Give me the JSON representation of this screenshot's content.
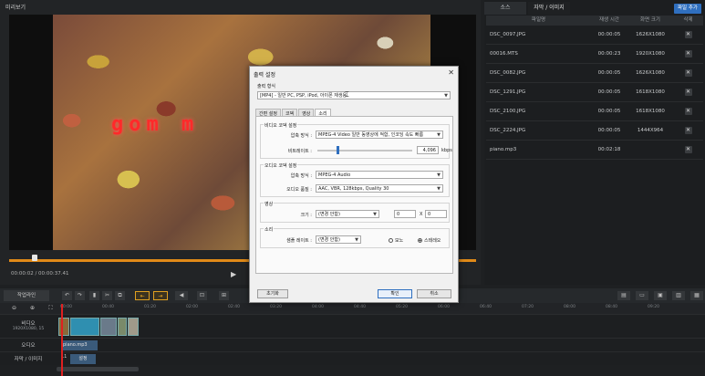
{
  "preview": {
    "title": "미리보기",
    "overlay_text": "gom m",
    "time": "00:00:02 / 00:00:37.41",
    "play_icon": "play-icon"
  },
  "source_panel": {
    "tabs": [
      "소스",
      "자막 / 이미지"
    ],
    "add_file_label": "파일 추가",
    "headers": {
      "name": "파일명",
      "duration": "재생 시간",
      "size": "화면 크기",
      "delete": "삭제"
    },
    "rows": [
      {
        "name": "DSC_0097.JPG",
        "duration": "00:00:05",
        "size": "1626X1080"
      },
      {
        "name": "00016.MTS",
        "duration": "00:00:23",
        "size": "1920X1080"
      },
      {
        "name": "DSC_0082.JPG",
        "duration": "00:00:05",
        "size": "1626X1080"
      },
      {
        "name": "DSC_1291.JPG",
        "duration": "00:00:05",
        "size": "1618X1080"
      },
      {
        "name": "DSC_2100.JPG",
        "duration": "00:00:05",
        "size": "1618X1080"
      },
      {
        "name": "DSC_2224.JPG",
        "duration": "00:00:05",
        "size": "1444X964"
      },
      {
        "name": "piano.mp3",
        "duration": "00:02:18",
        "size": ""
      }
    ],
    "delete_glyph": "✕"
  },
  "timeline": {
    "workline_label": "작업라인",
    "ruler": [
      "00:00",
      "00:40",
      "01:20",
      "02:00",
      "02:40",
      "03:20",
      "04:00",
      "04:40",
      "05:20",
      "06:00",
      "06:40",
      "07:20",
      "08:00",
      "08:40",
      "09:20"
    ],
    "tracks": {
      "video_label": "비디오",
      "video_sub": "1920X1080, 15",
      "audio_label": "오디오",
      "audio_clip": "piano.mp3",
      "subtitle_label": "자막 / 이미지",
      "subtitle_mark": "11",
      "subtitle_clip": "설정"
    }
  },
  "dialog": {
    "title": "출력 설정",
    "format_label": "출력 형식",
    "format_value": "[MP4] - 일반 PC, PSP, iPod, 아이폰 재생용",
    "tabs": [
      "간편 설정",
      "코덱",
      "영상",
      "소리"
    ],
    "video_codec_group": "비디오 코덱 설정",
    "compress_label": "압축 방식 :",
    "compress_value": "MPEG-4 Video 일반 동영상에 적합, 인코딩 속도 빠름",
    "bitrate_label": "비트레이트 :",
    "bitrate_value": "4,096",
    "bitrate_unit": "kbps",
    "bitrate_fraction": 0.2,
    "audio_codec_group": "오디오 코덱 설정",
    "audio_compress_label": "압축 방식 :",
    "audio_compress_value": "MPEG-4 Audio",
    "audio_quality_label": "오디오 품질 :",
    "audio_quality_value": "AAC, VBR, 128kbps, Quality 30",
    "video_group": "영상",
    "size_label": "크기 :",
    "size_value": "(변경 안함)",
    "width_value": "0",
    "height_value": "0",
    "times_glyph": "X",
    "sound_group": "소리",
    "sample_rate_label": "샘플 레이트 :",
    "sample_rate_value": "(변경 안함)",
    "mono_label": "모노",
    "stereo_label": "스테레오",
    "reset_label": "초기화",
    "ok_label": "확인",
    "cancel_label": "취소",
    "close_glyph": "✕"
  }
}
